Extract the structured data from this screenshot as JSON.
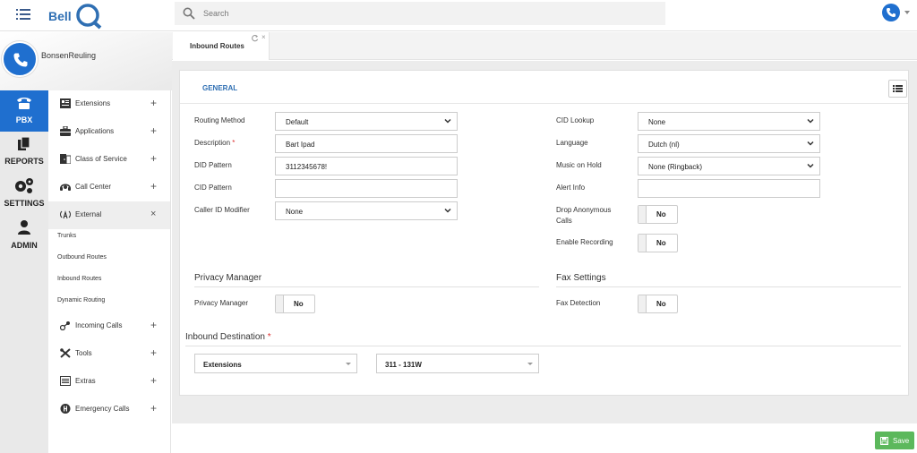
{
  "app": {
    "logo_text": "Bell Q"
  },
  "search": {
    "placeholder": "Search"
  },
  "user": {
    "name": "BonsenReuling"
  },
  "rail": [
    {
      "label": "PBX",
      "icon": "phone-icon"
    },
    {
      "label": "REPORTS",
      "icon": "copy-icon"
    },
    {
      "label": "SETTINGS",
      "icon": "gears-icon"
    },
    {
      "label": "ADMIN",
      "icon": "user-icon"
    }
  ],
  "menu": {
    "extensions": "Extensions",
    "applications": "Applications",
    "class_of_service": "Class of Service",
    "call_center": "Call Center",
    "external": "External",
    "external_sub": [
      "Trunks",
      "Outbound Routes",
      "Inbound Routes",
      "Dynamic Routing"
    ],
    "incoming_calls": "Incoming Calls",
    "tools": "Tools",
    "extras": "Extras",
    "emergency_calls": "Emergency Calls",
    "plus": "+",
    "close": "×"
  },
  "tab": {
    "label": "Inbound Routes",
    "close": "×"
  },
  "card": {
    "title": "GENERAL"
  },
  "form": {
    "routing_method": {
      "label": "Routing Method",
      "value": "Default"
    },
    "description": {
      "label": "Description",
      "value": "Bart Ipad"
    },
    "did_pattern": {
      "label": "DID Pattern",
      "value": "3112345678!"
    },
    "cid_pattern": {
      "label": "CID Pattern",
      "value": ""
    },
    "caller_id_modifier": {
      "label": "Caller ID Modifier",
      "value": "None"
    },
    "cid_lookup": {
      "label": "CID Lookup",
      "value": "None"
    },
    "language": {
      "label": "Language",
      "value": "Dutch (nl)"
    },
    "music_on_hold": {
      "label": "Music on Hold",
      "value": "None (Ringback)"
    },
    "alert_info": {
      "label": "Alert Info",
      "value": ""
    },
    "drop_anonymous_1": "Drop Anonymous",
    "drop_anonymous_2": "Calls",
    "drop_anonymous_value": "No",
    "enable_recording": {
      "label": "Enable Recording",
      "value": "No"
    },
    "required_mark": "*"
  },
  "privacy": {
    "section": "Privacy Manager",
    "label": "Privacy Manager",
    "value": "No"
  },
  "fax": {
    "section": "Fax Settings",
    "label": "Fax Detection",
    "value": "No"
  },
  "inbound_destination": {
    "label": "Inbound Destination",
    "type": "Extensions",
    "target": "311 - 131W"
  },
  "save": {
    "label": "Save"
  },
  "colors": {
    "accent": "#1f6fcf",
    "save": "#5cb85c",
    "link": "#2f6fb3"
  }
}
